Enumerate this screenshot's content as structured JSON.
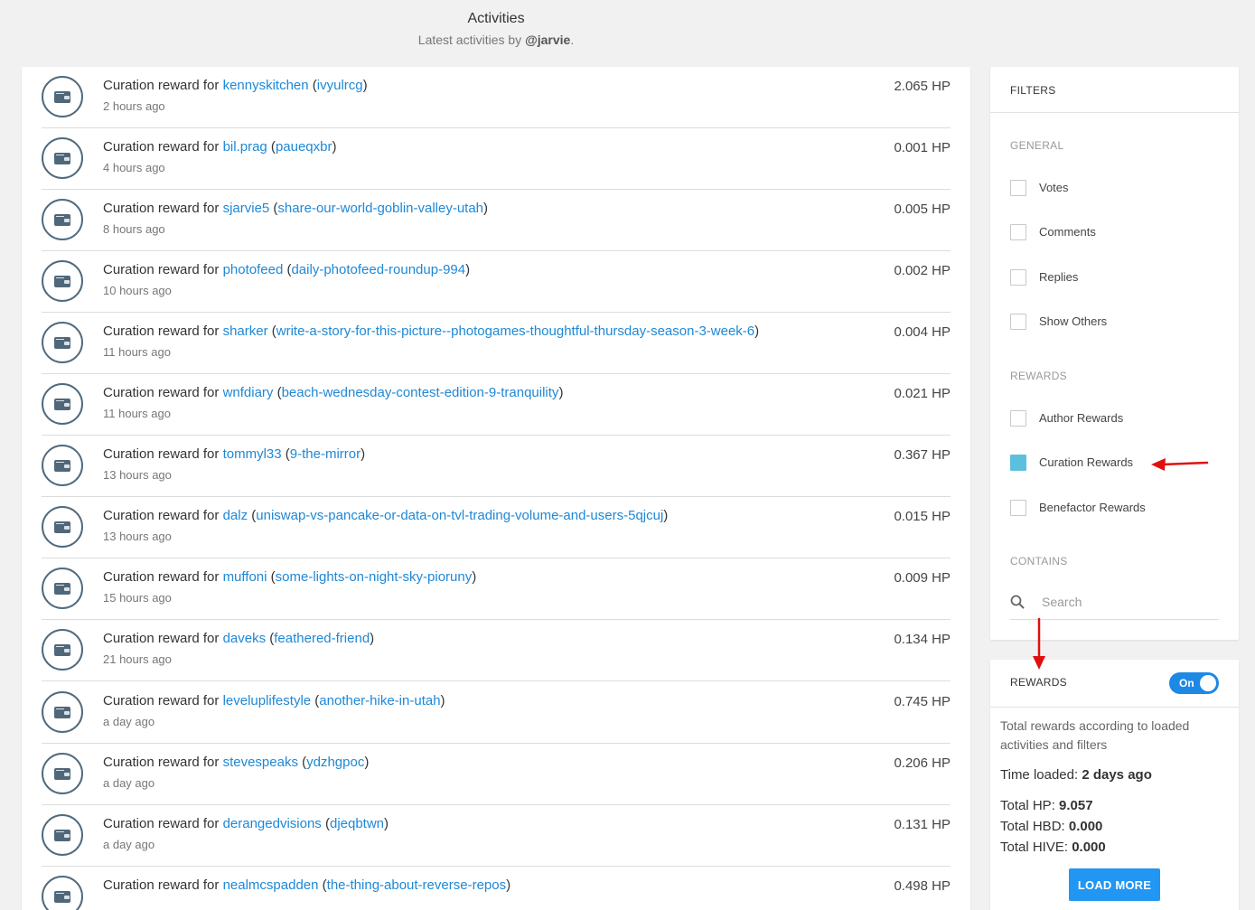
{
  "header": {
    "title": "Activities",
    "subtitle_prefix": "Latest activities by ",
    "username": "@jarvie",
    "subtitle_suffix": "."
  },
  "activities": [
    {
      "prefix": "Curation reward for ",
      "author": "kennyskitchen",
      "permlink": "ivyulrcg",
      "time": "2 hours ago",
      "amount": "2.065 HP"
    },
    {
      "prefix": "Curation reward for ",
      "author": "bil.prag",
      "permlink": "paueqxbr",
      "time": "4 hours ago",
      "amount": "0.001 HP"
    },
    {
      "prefix": "Curation reward for ",
      "author": "sjarvie5",
      "permlink": "share-our-world-goblin-valley-utah",
      "time": "8 hours ago",
      "amount": "0.005 HP"
    },
    {
      "prefix": "Curation reward for ",
      "author": "photofeed",
      "permlink": "daily-photofeed-roundup-994",
      "time": "10 hours ago",
      "amount": "0.002 HP"
    },
    {
      "prefix": "Curation reward for ",
      "author": "sharker",
      "permlink": "write-a-story-for-this-picture--photogames-thoughtful-thursday-season-3-week-6",
      "time": "11 hours ago",
      "amount": "0.004 HP"
    },
    {
      "prefix": "Curation reward for ",
      "author": "wnfdiary",
      "permlink": "beach-wednesday-contest-edition-9-tranquility",
      "time": "11 hours ago",
      "amount": "0.021 HP"
    },
    {
      "prefix": "Curation reward for ",
      "author": "tommyl33",
      "permlink": "9-the-mirror",
      "time": "13 hours ago",
      "amount": "0.367 HP"
    },
    {
      "prefix": "Curation reward for ",
      "author": "dalz",
      "permlink": "uniswap-vs-pancake-or-data-on-tvl-trading-volume-and-users-5qjcuj",
      "time": "13 hours ago",
      "amount": "0.015 HP"
    },
    {
      "prefix": "Curation reward for ",
      "author": "muffoni",
      "permlink": "some-lights-on-night-sky-pioruny",
      "time": "15 hours ago",
      "amount": "0.009 HP"
    },
    {
      "prefix": "Curation reward for ",
      "author": "daveks",
      "permlink": "feathered-friend",
      "time": "21 hours ago",
      "amount": "0.134 HP"
    },
    {
      "prefix": "Curation reward for ",
      "author": "leveluplifestyle",
      "permlink": "another-hike-in-utah",
      "time": "a day ago",
      "amount": "0.745 HP"
    },
    {
      "prefix": "Curation reward for ",
      "author": "stevespeaks",
      "permlink": "ydzhgpoc",
      "time": "a day ago",
      "amount": "0.206 HP"
    },
    {
      "prefix": "Curation reward for ",
      "author": "derangedvisions",
      "permlink": "djeqbtwn",
      "time": "a day ago",
      "amount": "0.131 HP"
    },
    {
      "prefix": "Curation reward for ",
      "author": "nealmcspadden",
      "permlink": "the-thing-about-reverse-repos",
      "time": "",
      "amount": "0.498 HP"
    }
  ],
  "filters": {
    "title": "FILTERS",
    "general_label": "GENERAL",
    "general": [
      {
        "label": "Votes",
        "checked": false
      },
      {
        "label": "Comments",
        "checked": false
      },
      {
        "label": "Replies",
        "checked": false
      },
      {
        "label": "Show Others",
        "checked": false
      }
    ],
    "rewards_label": "REWARDS",
    "rewards": [
      {
        "label": "Author Rewards",
        "checked": false
      },
      {
        "label": "Curation Rewards",
        "checked": true
      },
      {
        "label": "Benefactor Rewards",
        "checked": false
      }
    ],
    "contains_label": "CONTAINS",
    "search_placeholder": "Search",
    "checked_color": "#5bc0de"
  },
  "rewards_panel": {
    "title": "REWARDS",
    "toggle_label": "On",
    "toggle_on": true,
    "description": "Total rewards according to loaded activities and filters",
    "time_loaded_label": "Time loaded: ",
    "time_loaded_value": "2 days ago",
    "total_hp_label": "Total HP: ",
    "total_hp_value": "9.057",
    "total_hbd_label": "Total HBD: ",
    "total_hbd_value": "0.000",
    "total_hive_label": "Total HIVE: ",
    "total_hive_value": "0.000",
    "load_more_label": "LOAD MORE"
  },
  "colors": {
    "link": "#1e88d6",
    "accent": "#2196f3",
    "annotation_arrow": "#e01010"
  }
}
